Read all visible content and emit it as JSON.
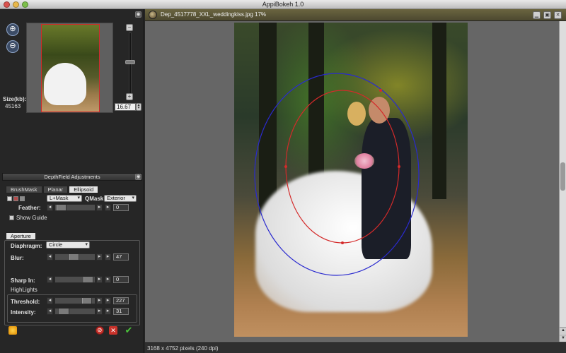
{
  "app": {
    "title": "AppiBokeh 1.0"
  },
  "navigator": {
    "size_label": "Size(kb):",
    "size_value": "45163",
    "zoom_value": "16.67",
    "zoom_in_icon": "zoom-in-icon",
    "zoom_out_icon": "zoom-out-icon"
  },
  "depthfield": {
    "header": "DepthField Adjustments",
    "tabs": [
      {
        "label": "BrushMask",
        "active": false
      },
      {
        "label": "Planar",
        "active": false
      },
      {
        "label": "Ellipsoid",
        "active": true
      }
    ],
    "mask_mode": "L+Mask",
    "qmask_label": "QMask:",
    "qmask_value": "Exterior",
    "feather_label": "Feather:",
    "feather_value": "0",
    "show_guide_label": "Show Guide"
  },
  "aperture": {
    "tab_label": "Aperture",
    "diaphragm_label": "Diaphragm:",
    "diaphragm_value": "Circle",
    "blur_label": "Blur:",
    "blur_value": "47",
    "sharp_in_label": "Sharp In:",
    "sharp_in_value": "0",
    "highlights_label": "HighLights",
    "threshold_label": "Threshold:",
    "threshold_value": "227",
    "intensity_label": "Intensity:",
    "intensity_value": "31"
  },
  "document": {
    "title": "Dep_4517778_XXL_weddingkiss.jpg 17%",
    "status": "3168 x 4752 pixels (240 dpi)"
  },
  "colors": {
    "guide_outer": "#2a2acf",
    "guide_inner": "#d42a2a",
    "frame_red": "#d02a2a"
  }
}
